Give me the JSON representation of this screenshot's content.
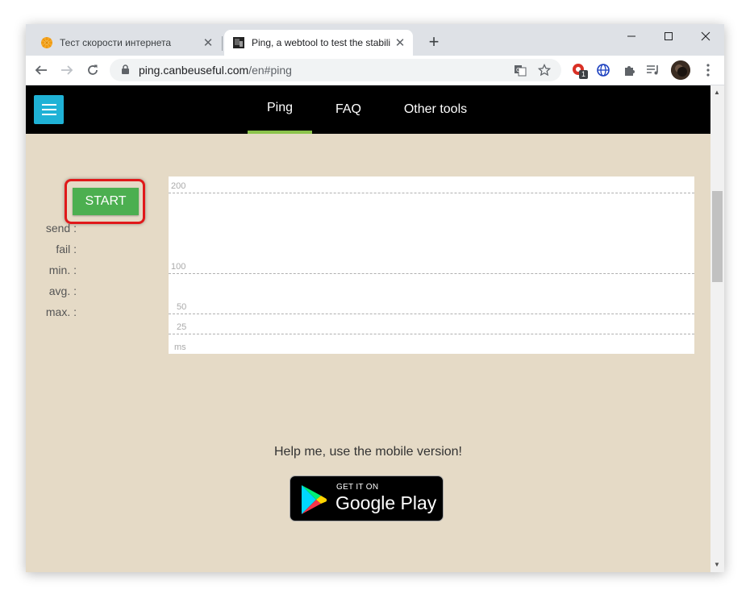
{
  "browser": {
    "tabs": [
      {
        "title": "Тест скорости интернета",
        "active": false
      },
      {
        "title": "Ping, a webtool to test the stabili",
        "active": true
      }
    ],
    "new_tab_label": "+",
    "url_domain": "ping.canbeuseful.com",
    "url_path": "/en#ping",
    "extension_badge": "1",
    "icons": [
      "back-icon",
      "forward-icon",
      "reload-icon",
      "lock-icon",
      "translate-icon",
      "star-icon",
      "puzzle-icon",
      "media-icon",
      "menu-icon"
    ]
  },
  "site": {
    "nav": [
      {
        "label": "Ping",
        "active": true
      },
      {
        "label": "FAQ",
        "active": false
      },
      {
        "label": "Other tools",
        "active": false
      }
    ],
    "accent_color": "#8bc34a",
    "menu_button_color": "#1fb2d6"
  },
  "ping": {
    "start_label": "START",
    "stats": [
      {
        "label": "send :"
      },
      {
        "label": "fail :"
      },
      {
        "label": "min. :"
      },
      {
        "label": "avg. :"
      },
      {
        "label": "max. :"
      }
    ],
    "grid_labels": [
      "200",
      "100",
      "50",
      "25",
      "ms"
    ]
  },
  "promo": {
    "text": "Help me, use the mobile version!",
    "badge_top": "GET IT ON",
    "badge_main": "Google Play"
  }
}
